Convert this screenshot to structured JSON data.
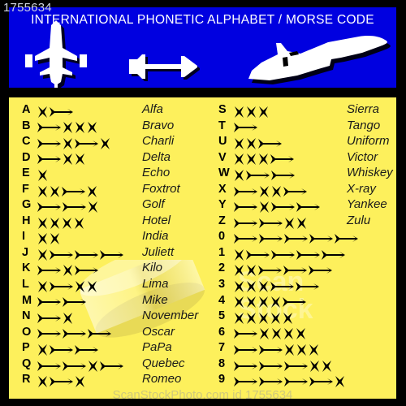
{
  "corner_id": "1755634",
  "header": {
    "title": "INTERNATIONAL   PHONETIC   ALPHABET / MORSE   CODE",
    "background_color": "#0000e0",
    "text_color": "#ffffff",
    "icons": [
      "fighter-jet-front-icon",
      "missile-icon",
      "fighter-jet-side-icon"
    ]
  },
  "table": {
    "background_color": "#fdf05c",
    "dot_glyph": "star-dot-icon",
    "dash_glyph": "arrow-dash-icon",
    "left_column": [
      {
        "char": "A",
        "code": ".-",
        "word": "Alfa"
      },
      {
        "char": "B",
        "code": "-...",
        "word": "Bravo"
      },
      {
        "char": "C",
        "code": "-.-.",
        "word": "Charli"
      },
      {
        "char": "D",
        "code": "-..",
        "word": "Delta"
      },
      {
        "char": "E",
        "code": ".",
        "word": "Echo"
      },
      {
        "char": "F",
        "code": "..-.",
        "word": "Foxtrot"
      },
      {
        "char": "G",
        "code": "--.",
        "word": "Golf"
      },
      {
        "char": "H",
        "code": "....",
        "word": "Hotel"
      },
      {
        "char": "I",
        "code": "..",
        "word": "India"
      },
      {
        "char": "J",
        "code": ".---",
        "word": "Juliett"
      },
      {
        "char": "K",
        "code": "-.-",
        "word": "Kilo"
      },
      {
        "char": "L",
        "code": ".-..",
        "word": "Lima"
      },
      {
        "char": "M",
        "code": "--",
        "word": "Mike"
      },
      {
        "char": "N",
        "code": "-.",
        "word": "November"
      },
      {
        "char": "O",
        "code": "---",
        "word": "Oscar"
      },
      {
        "char": "P",
        "code": ".--",
        "word": "PaPa"
      },
      {
        "char": "Q",
        "code": "--.-",
        "word": "Quebec"
      },
      {
        "char": "R",
        "code": ".-.",
        "word": "Romeo"
      }
    ],
    "right_column": [
      {
        "char": "S",
        "code": "...",
        "word": "Sierra"
      },
      {
        "char": "T",
        "code": "-",
        "word": "Tango"
      },
      {
        "char": "U",
        "code": "..-",
        "word": "Uniform"
      },
      {
        "char": "V",
        "code": "...-",
        "word": "Victor"
      },
      {
        "char": "W",
        "code": ".--",
        "word": "Whiskey"
      },
      {
        "char": "X",
        "code": "-..-",
        "word": "X-ray"
      },
      {
        "char": "Y",
        "code": "-.--",
        "word": "Yankee"
      },
      {
        "char": "Z",
        "code": "--..",
        "word": "Zulu"
      },
      {
        "char": "0",
        "code": "-----",
        "word": ""
      },
      {
        "char": "1",
        "code": ".----",
        "word": ""
      },
      {
        "char": "2",
        "code": "..---",
        "word": ""
      },
      {
        "char": "3",
        "code": "...--",
        "word": ""
      },
      {
        "char": "4",
        "code": "....-",
        "word": ""
      },
      {
        "char": "5",
        "code": ".....",
        "word": ""
      },
      {
        "char": "6",
        "code": "-....",
        "word": ""
      },
      {
        "char": "7",
        "code": "--...",
        "word": ""
      },
      {
        "char": "8",
        "code": "---..",
        "word": ""
      },
      {
        "char": "9",
        "code": "----.",
        "word": ""
      }
    ]
  },
  "watermarks": {
    "brand": "Scan\nStock",
    "bottom": "ScanStockPhoto.com  id 1755634"
  }
}
